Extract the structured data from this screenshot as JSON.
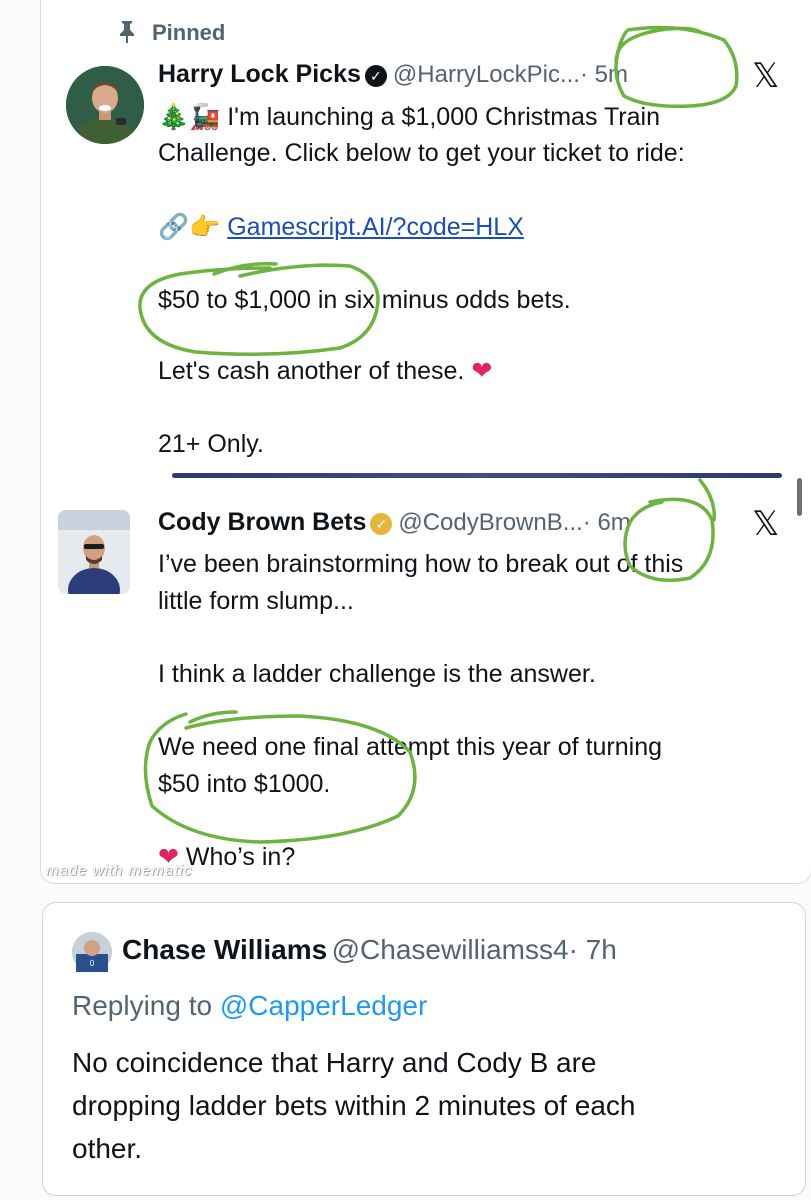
{
  "pinned_tweet": {
    "pinned_label": "Pinned",
    "name": "Harry Lock Picks",
    "handle": "@HarryLockPic...",
    "time": "· 5m",
    "line1_emojis": "🎄🚂",
    "line1": "I'm launching a $1,000 Christmas Train",
    "line2": "Challenge. Click below to get your ticket to ride:",
    "link_emojis": "🔗👉",
    "link_text": "Gamescript.AI/?code=HLX",
    "line3": "$50 to $1,000 in six minus odds bets.",
    "line4": "Let's cash another of these.",
    "heart": "❤",
    "line5": "21+ Only."
  },
  "second_tweet": {
    "name": "Cody Brown Bets",
    "handle": "@CodyBrownB...",
    "time": "· 6m",
    "line1": "I’ve been brainstorming how to break out of this",
    "line2": "little form slump...",
    "line3": "I think a ladder challenge is the answer.",
    "line4": "We need one final attempt this year of turning",
    "line5": "$50 into $1000.",
    "heart": "❤",
    "line6": "Who’s in?"
  },
  "watermark": "made with mematic",
  "reply": {
    "name": "Chase Williams",
    "handle": "@Chasewilliamss4",
    "time": "· 7h",
    "replying_prefix": "Replying to",
    "replying_to": "@CapperLedger",
    "body_line1": "No coincidence that Harry and Cody B are",
    "body_line2": "dropping ladder bets within 2 minutes of each",
    "body_line3": "other."
  },
  "icons": {
    "x_logo": "𝕏",
    "verified_check": "✓"
  },
  "colors": {
    "annotation_green": "#6cb33f",
    "link_blue": "#1a4fb5",
    "mention_blue": "#1d9bf0",
    "gold_badge": "#e8b53b"
  }
}
